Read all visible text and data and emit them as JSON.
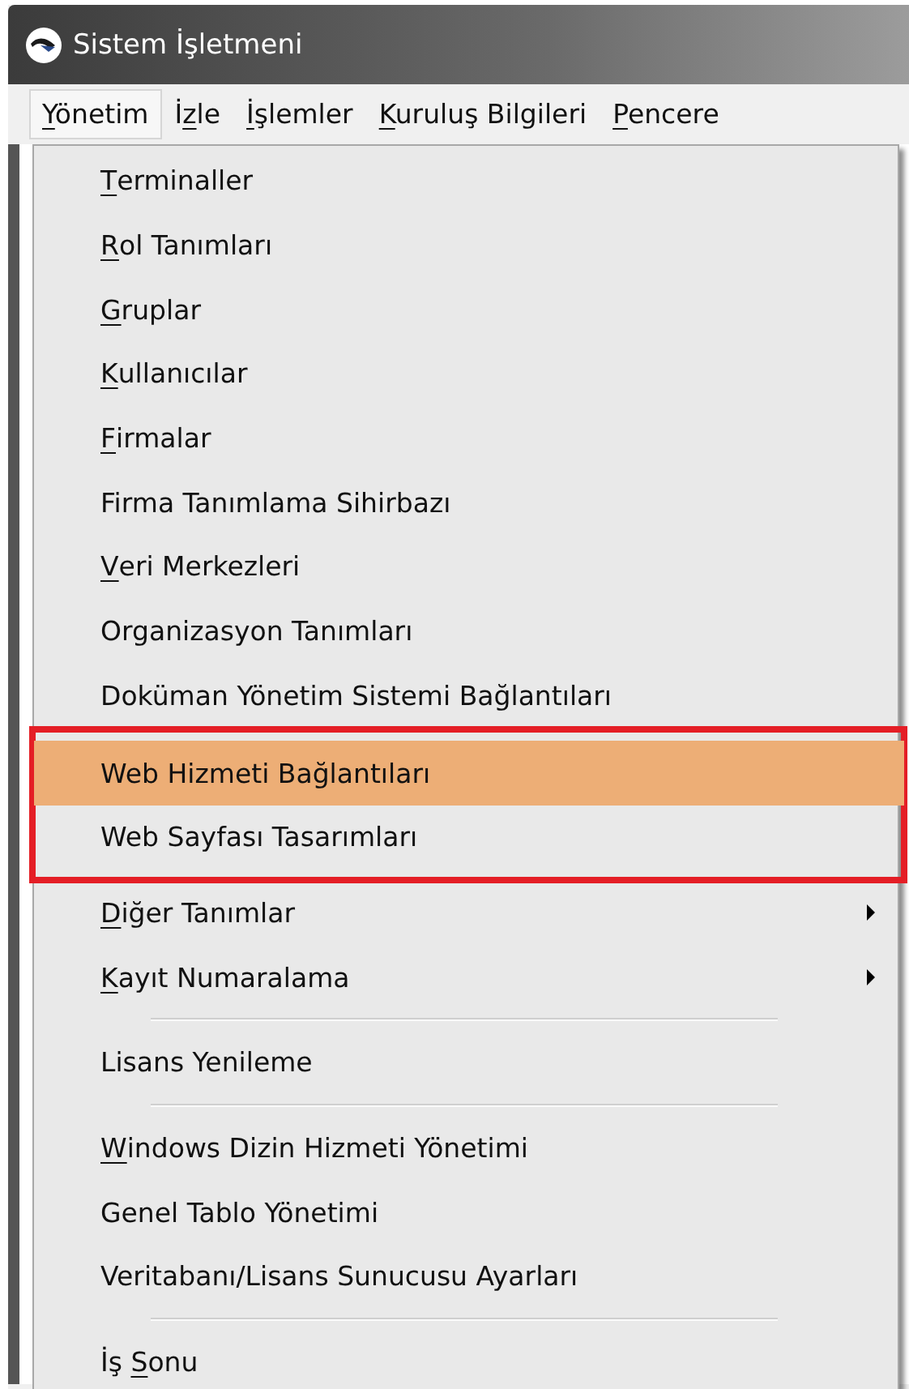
{
  "window": {
    "title": "Sistem İşletmeni"
  },
  "menubar": [
    {
      "label": "Yönetim",
      "underline": [
        true
      ],
      "selected": true
    },
    {
      "label": "İzle",
      "underline": [
        false,
        true
      ],
      "selected": false
    },
    {
      "label": "İşlemler",
      "underline": [
        true
      ],
      "selected": false
    },
    {
      "label": "Kuruluş Bilgileri",
      "underline": [
        true
      ],
      "selected": false
    },
    {
      "label": "Pencere",
      "underline": [
        true
      ],
      "selected": false
    }
  ],
  "menu": [
    {
      "kind": "item",
      "label": "Terminaller",
      "underline": [
        true
      ],
      "highlighted": false,
      "framed": false
    },
    {
      "kind": "item",
      "label": "Rol Tanımları",
      "underline": [
        true
      ],
      "highlighted": false,
      "framed": false
    },
    {
      "kind": "item",
      "label": "Gruplar",
      "underline": [
        true
      ],
      "highlighted": false,
      "framed": false
    },
    {
      "kind": "item",
      "label": "Kullanıcılar",
      "underline": [
        true
      ],
      "highlighted": false,
      "framed": false
    },
    {
      "kind": "item",
      "label": "Firmalar",
      "underline": [
        true
      ],
      "highlighted": false,
      "framed": false
    },
    {
      "kind": "item",
      "label": "Firma Tanımlama Sihirbazı",
      "highlighted": false,
      "framed": false
    },
    {
      "kind": "item",
      "label": "Veri Merkezleri",
      "underline": [
        true
      ],
      "highlighted": false,
      "framed": false
    },
    {
      "kind": "item",
      "label": "Organizasyon Tanımları",
      "highlighted": false,
      "framed": false
    },
    {
      "kind": "item",
      "label": "Doküman Yönetim Sistemi Bağlantıları",
      "highlighted": false,
      "framed": false
    },
    {
      "kind": "item",
      "label": "Web Hizmeti Bağlantıları",
      "highlighted": true,
      "framed": true
    },
    {
      "kind": "item",
      "label": "Web Sayfası Tasarımları",
      "highlighted": false,
      "framed": true
    },
    {
      "kind": "submenu",
      "label": "Diğer Tanımlar",
      "underline": [
        true
      ],
      "highlighted": false,
      "framed": false
    },
    {
      "kind": "submenu",
      "label": "Kayıt Numaralama",
      "underline": [
        true
      ],
      "highlighted": false,
      "framed": false
    },
    {
      "kind": "separator"
    },
    {
      "kind": "item",
      "label": "Lisans Yenileme",
      "highlighted": false,
      "framed": false
    },
    {
      "kind": "separator"
    },
    {
      "kind": "item",
      "label": "Windows Dizin Hizmeti Yönetimi",
      "underline": [
        true
      ],
      "highlighted": false,
      "framed": false
    },
    {
      "kind": "item",
      "label": "Genel Tablo Yönetimi",
      "highlighted": false,
      "framed": false
    },
    {
      "kind": "item",
      "label": "Veritabanı/Lisans Sunucusu Ayarları",
      "highlighted": false,
      "framed": false
    },
    {
      "kind": "separator"
    },
    {
      "kind": "item",
      "label": "İş Sonu",
      "underline": [
        false,
        false,
        false,
        true
      ],
      "highlighted": false,
      "framed": false
    }
  ]
}
